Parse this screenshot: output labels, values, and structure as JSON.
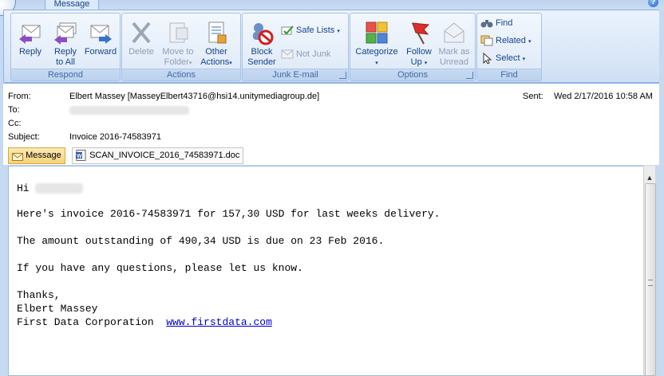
{
  "window": {
    "tab_label": "Message",
    "help_symbol": "?"
  },
  "ribbon": {
    "groups": [
      {
        "label": "Respond",
        "buttons": [
          "Reply",
          "Reply to All",
          "Forward"
        ]
      },
      {
        "label": "Actions",
        "buttons": [
          "Delete",
          "Move to Folder",
          "Other Actions"
        ]
      },
      {
        "label": "Junk E-mail",
        "buttons": [
          "Block Sender",
          "Safe Lists",
          "Not Junk"
        ]
      },
      {
        "label": "Options",
        "buttons": [
          "Categorize",
          "Follow Up",
          "Mark as Unread"
        ]
      },
      {
        "label": "Find",
        "buttons": [
          "Find",
          "Related",
          "Select"
        ]
      }
    ],
    "reply": {
      "line1": "Reply",
      "line2": ""
    },
    "reply_all": {
      "line1": "Reply",
      "line2": "to All"
    },
    "forward": {
      "line1": "Forward",
      "line2": ""
    },
    "delete": {
      "line1": "Delete",
      "line2": ""
    },
    "move_to_folder": {
      "line1": "Move to",
      "line2": "Folder"
    },
    "other_actions": {
      "line1": "Other",
      "line2": "Actions"
    },
    "block_sender": {
      "line1": "Block",
      "line2": "Sender"
    },
    "safe_lists": "Safe Lists",
    "not_junk": "Not Junk",
    "categorize": "Categorize",
    "follow_up": {
      "line1": "Follow",
      "line2": "Up"
    },
    "mark_unread": {
      "line1": "Mark as",
      "line2": "Unread"
    },
    "find": "Find",
    "related": "Related",
    "select": "Select",
    "caret": "▾"
  },
  "header": {
    "from_label": "From:",
    "from_value": "Elbert Massey [MasseyElbert43716@hsi14.unitymediagroup.de]",
    "to_label": "To:",
    "cc_label": "Cc:",
    "subject_label": "Subject:",
    "subject_value": "Invoice 2016-74583971",
    "sent_label": "Sent:",
    "sent_value": "Wed 2/17/2016 10:58 AM"
  },
  "attachments": {
    "message_tab": "Message",
    "file_name": "SCAN_INVOICE_2016_74583971.doc"
  },
  "body": {
    "greeting": "Hi",
    "line1": "Here's invoice 2016-74583971 for 157,30 USD for last weeks delivery.",
    "line2": "The amount outstanding of 490,34 USD is due on 23 Feb 2016.",
    "line3": "If you have any questions, please let us know.",
    "closing": "Thanks,",
    "signature_name": "Elbert Massey",
    "signature_company": "First Data Corporation",
    "link_text": "www.firstdata.com"
  },
  "colors": {
    "ribbon_bg": "#dbe8f8",
    "text_blue": "#15428b",
    "link": "#0000cc",
    "message_tab": "#f6d37b"
  }
}
